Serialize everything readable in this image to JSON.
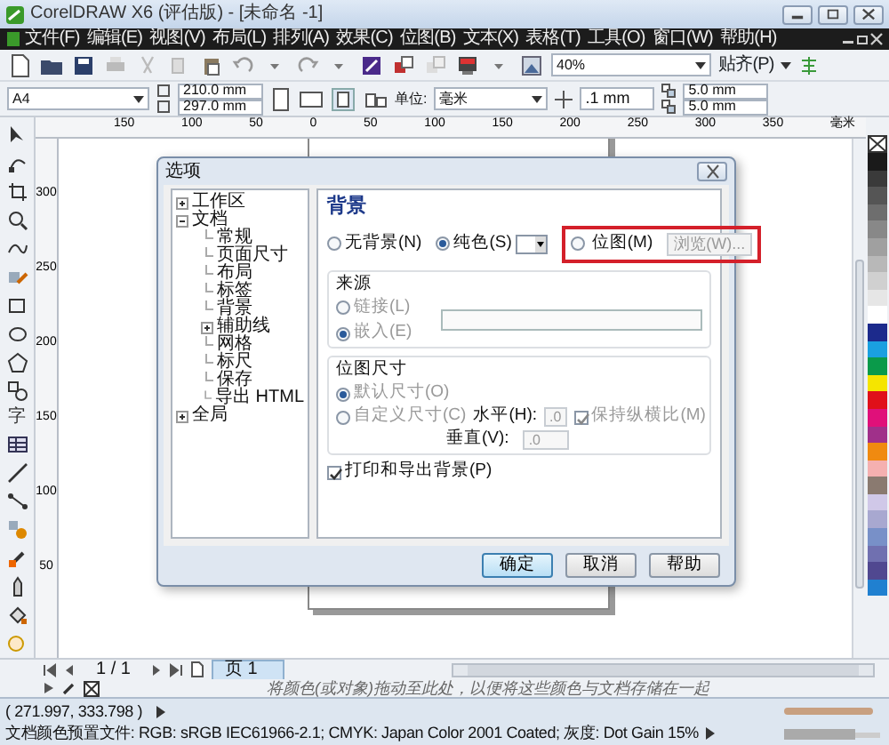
{
  "window": {
    "title": "CorelDRAW X6 (评估版) - [未命名 -1]"
  },
  "menu": [
    "文件(F)",
    "编辑(E)",
    "视图(V)",
    "布局(L)",
    "排列(A)",
    "效果(C)",
    "位图(B)",
    "文本(X)",
    "表格(T)",
    "工具(O)",
    "窗口(W)",
    "帮助(H)"
  ],
  "standard_toolbar": {
    "zoom": "40%",
    "snap": "贴齐(P)"
  },
  "property_bar": {
    "page_size": "A4",
    "width": "210.0 mm",
    "height": "297.0 mm",
    "units_label": "单位:",
    "units": "毫米",
    "nudge": ".1 mm",
    "dup_x": "5.0 mm",
    "dup_y": "5.0 mm"
  },
  "rulers": {
    "horizontal": [
      "150",
      "100",
      "50",
      "0",
      "50",
      "100",
      "150",
      "200",
      "250",
      "300",
      "350"
    ],
    "horizontal_unit": "毫米",
    "vertical": [
      "300",
      "250",
      "200",
      "150",
      "100",
      "50"
    ]
  },
  "toolbox": {
    "text_tool": "字"
  },
  "dialog": {
    "title": "选项",
    "tree": [
      {
        "label": "工作区",
        "expanded": false
      },
      {
        "label": "文档",
        "expanded": true,
        "children": [
          {
            "label": "常规"
          },
          {
            "label": "页面尺寸"
          },
          {
            "label": "布局"
          },
          {
            "label": "标签"
          },
          {
            "label": "背景"
          },
          {
            "label": "辅助线",
            "expanded": false
          },
          {
            "label": "网格"
          },
          {
            "label": "标尺"
          },
          {
            "label": "保存"
          },
          {
            "label": "导出 HTML"
          }
        ]
      },
      {
        "label": "全局",
        "expanded": false
      }
    ],
    "heading": "背景",
    "bg_options": [
      {
        "label": "无背景(N)",
        "selected": false
      },
      {
        "label": "纯色(S)",
        "selected": true
      },
      {
        "label": "位图(M)",
        "selected": false
      }
    ],
    "highlight_box": true,
    "browse_button": {
      "label": "浏览(W)...",
      "disabled": true
    },
    "source": {
      "title": "来源",
      "disabled": true,
      "options": [
        {
          "label": "链接(L)",
          "selected": false
        },
        {
          "label": "嵌入(E)",
          "selected": true
        }
      ]
    },
    "bitmap_size": {
      "title": "位图尺寸",
      "disabled": true,
      "options": [
        {
          "label": "默认尺寸(O)",
          "selected": true
        },
        {
          "label": "自定义尺寸(C)",
          "selected": false
        }
      ],
      "horizontal_label": "水平(H):",
      "horizontal": ".0",
      "vertical_label": "垂直(V):",
      "vertical": ".0",
      "keep_ratio": {
        "label": "保持纵横比(M)",
        "checked": true
      }
    },
    "print_bg": {
      "label": "打印和导出背景(P)",
      "checked": true
    },
    "buttons": [
      {
        "label": "确定",
        "default": true
      },
      {
        "label": "取消",
        "default": false
      },
      {
        "label": "帮助",
        "default": false
      }
    ]
  },
  "page_nav": {
    "counter": "1 / 1",
    "tab": "页 1"
  },
  "palette_hint": "将颜色(或对象)拖动至此处，以便将这些颜色与文档存储在一起",
  "status": {
    "coords": "( 271.997, 333.798 )",
    "profile": "文档颜色预置文件: RGB: sRGB IEC61966-2.1; CMYK: Japan Color 2001 Coated; 灰度: Dot Gain 15%"
  },
  "palette": [
    {
      "color": "#1a1a1a"
    },
    {
      "color": "#3a3a3a"
    },
    {
      "color": "#555555"
    },
    {
      "color": "#6e6e6e"
    },
    {
      "color": "#888888"
    },
    {
      "color": "#a0a0a0"
    },
    {
      "color": "#b8b8b8"
    },
    {
      "color": "#d0d0d0"
    },
    {
      "color": "#e6e6e6"
    },
    {
      "color": "#ffffff"
    },
    {
      "color": "#1c2a8c"
    },
    {
      "color": "#1aa0e0"
    },
    {
      "color": "#0a9a4a"
    },
    {
      "color": "#f5e500"
    },
    {
      "color": "#e0101a"
    },
    {
      "color": "#e0107a"
    },
    {
      "color": "#a0308a"
    },
    {
      "color": "#f08a10"
    },
    {
      "color": "#f5b0b0"
    },
    {
      "color": "#8a7a70"
    },
    {
      "color": "#d0c8e8"
    },
    {
      "color": "#a8a8d0"
    },
    {
      "color": "#7890c8"
    },
    {
      "color": "#7070b0"
    },
    {
      "color": "#504890"
    },
    {
      "color": "#2080d0"
    }
  ]
}
